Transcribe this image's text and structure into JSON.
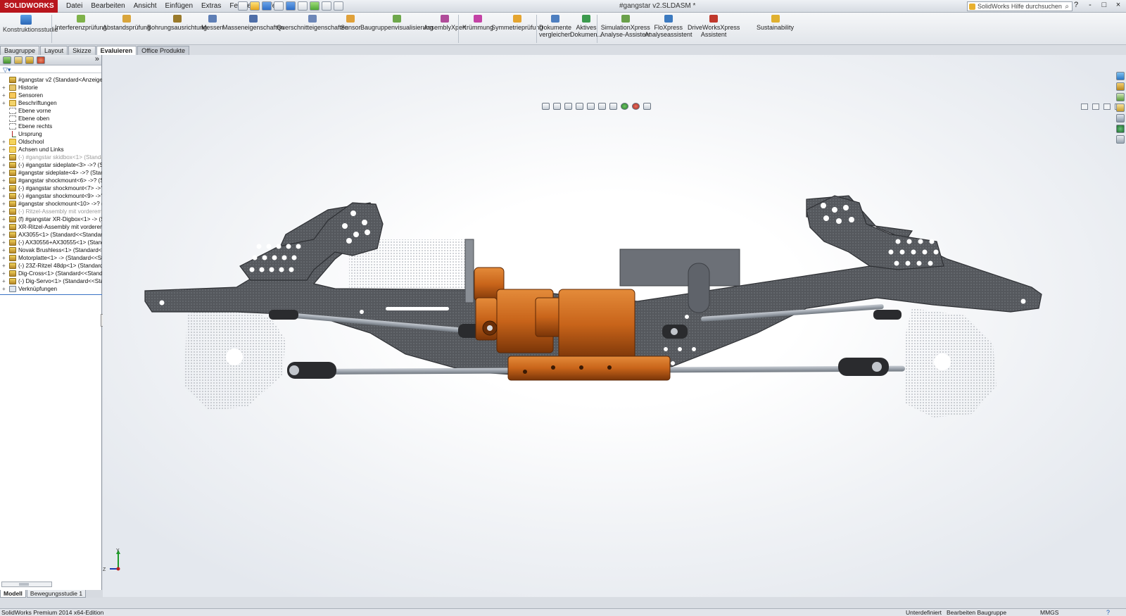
{
  "app": {
    "logo": "SOLIDWORKS",
    "document_title": "#gangstar v2.SLDASM *",
    "menu": [
      "Datei",
      "Bearbeiten",
      "Ansicht",
      "Einfügen",
      "Extras",
      "Fenster",
      "Hilfe"
    ],
    "help_search_placeholder": "SolidWorks Hilfe durchsuchen",
    "window_controls": [
      "?",
      "-",
      "□",
      "×"
    ]
  },
  "command_manager": {
    "konstruktionsstudie": "Konstruktionsstudie",
    "commands": [
      {
        "label1": "Interferenzprüfung",
        "label2": ""
      },
      {
        "label1": "Abstandsprüfung",
        "label2": ""
      },
      {
        "label1": "Bohrungsausrichtung",
        "label2": ""
      },
      {
        "label1": "Messen",
        "label2": ""
      },
      {
        "label1": "Masseneigenschaften",
        "label2": ""
      },
      {
        "label1": "Querschnitteigenschaften",
        "label2": ""
      },
      {
        "label1": "Sensor",
        "label2": ""
      },
      {
        "label1": "Baugruppenvisualisierung",
        "label2": ""
      },
      {
        "label1": "AssemblyXpert",
        "label2": ""
      },
      {
        "label1": "Krümmung",
        "label2": ""
      },
      {
        "label1": "Symmetrieprüfung",
        "label2": ""
      },
      {
        "label1": "Dokumente",
        "label2": "vergleichen"
      },
      {
        "label1": "Aktives",
        "label2": "Dokumen..."
      },
      {
        "label1": "SimulationXpress",
        "label2": "Analyse-Assistent"
      },
      {
        "label1": "FloXpress",
        "label2": "Analyseassistent"
      },
      {
        "label1": "DriveWorksXpress",
        "label2": "Assistent"
      },
      {
        "label1": "Sustainability",
        "label2": ""
      }
    ]
  },
  "tabs": [
    "Baugruppe",
    "Layout",
    "Skizze",
    "Evaluieren",
    "Office Produkte"
  ],
  "active_tab": "Evaluieren",
  "feature_tree": [
    {
      "label": "#gangstar v2  (Standard<Anzeigestatus-1>)",
      "icon": "assembly-icon",
      "grey": false
    },
    {
      "label": "Historie",
      "icon": "history-icon",
      "grey": false
    },
    {
      "label": "Sensoren",
      "icon": "sensor-icon",
      "grey": false
    },
    {
      "label": "Beschriftungen",
      "icon": "annotation-icon",
      "grey": false
    },
    {
      "label": "Ebene vorne",
      "icon": "plane-icon",
      "grey": false
    },
    {
      "label": "Ebene oben",
      "icon": "plane-icon",
      "grey": false
    },
    {
      "label": "Ebene rechts",
      "icon": "plane-icon",
      "grey": false
    },
    {
      "label": "Ursprung",
      "icon": "origin-icon",
      "grey": false
    },
    {
      "label": "Oldschool",
      "icon": "folder-icon",
      "grey": false
    },
    {
      "label": "Achsen und Links",
      "icon": "folder-icon",
      "grey": false
    },
    {
      "label": "(-) #gangstar skidbox<1> (Standard<<",
      "icon": "part-icon",
      "grey": true
    },
    {
      "label": "(-) #gangstar sideplate<3> ->? (Standard",
      "icon": "part-icon",
      "grey": false
    },
    {
      "label": "#gangstar sideplate<4> ->? (Standard<<",
      "icon": "part-icon",
      "grey": false
    },
    {
      "label": "#gangstar shockmount<6> ->? (Standard",
      "icon": "part-icon",
      "grey": false
    },
    {
      "label": "(-) #gangstar shockmount<7> ->? (Stan",
      "icon": "part-icon",
      "grey": false
    },
    {
      "label": "(-) #gangstar shockmount<9> ->? (Stan",
      "icon": "part-icon",
      "grey": false
    },
    {
      "label": "#gangstar shockmount<10> ->? (Standa",
      "icon": "part-icon",
      "grey": false
    },
    {
      "label": "(-) Ritzel-Assembly mit vorderem Ge",
      "icon": "part-icon",
      "grey": true
    },
    {
      "label": "(f) #gangstar XR-Digbox<1> -> (Stan",
      "icon": "part-icon",
      "grey": false
    },
    {
      "label": "XR-Ritzel-Assembly mit vorderem Ge",
      "icon": "part-icon",
      "grey": false
    },
    {
      "label": "AX3055<1> (Standard<<Standard>_An",
      "icon": "part-icon",
      "grey": false
    },
    {
      "label": "(-) AX30556+AX30555<1> (Standard<<",
      "icon": "part-icon",
      "grey": false
    },
    {
      "label": "Novak Brushless<1> (Standard<<Stand",
      "icon": "part-icon",
      "grey": false
    },
    {
      "label": "Motorplatte<1> -> (Standard<<Standa",
      "icon": "part-icon",
      "grey": false
    },
    {
      "label": "(-) 23Z-Ritzel 48dp<1> (Standard<<Sta",
      "icon": "part-icon",
      "grey": false
    },
    {
      "label": "Dig-Cross<1> (Standard<<Standard>_A",
      "icon": "part-icon",
      "grey": false
    },
    {
      "label": "(-) Dig-Servo<1> (Standard<<Standard",
      "icon": "part-icon",
      "grey": false
    },
    {
      "label": "Verknüpfungen",
      "icon": "mates-icon",
      "grey": false
    }
  ],
  "bottom_tabs": [
    "Modell",
    "Bewegungsstudie 1"
  ],
  "status": {
    "edition": "SolidWorks Premium 2014 x64-Edition",
    "definition": "Unterdefiniert",
    "mode": "Bearbeiten Baugruppe",
    "units": "MMGS",
    "help": "?"
  },
  "triad": {
    "y": "Y",
    "z": "Z"
  },
  "colors": {
    "frame": "#575a5f",
    "frame_dark": "#3a3c40",
    "orange": "#c8641a",
    "orange_dark": "#7a3508",
    "link_grey": "#9ca3ac",
    "logo_red": "#b9161d"
  }
}
